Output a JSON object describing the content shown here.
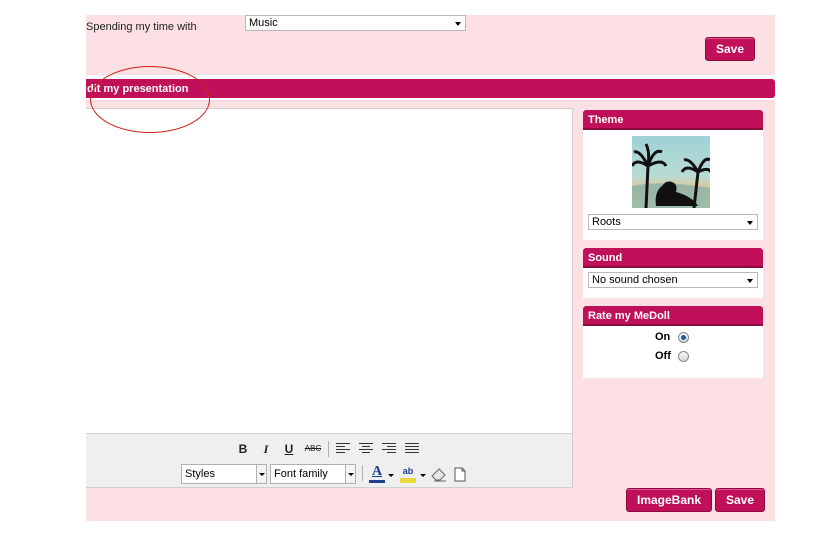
{
  "top": {
    "spending_label": "Spending my time with",
    "spending_value": "Music",
    "save_label": "Save"
  },
  "header": {
    "title": "dit my presentation"
  },
  "toolbar": {
    "bold": "B",
    "italic": "I",
    "underline": "U",
    "strikethrough": "ABC",
    "styles": "Styles",
    "font_family": "Font family",
    "font_color_letter": "A",
    "highlight_letters": "ab"
  },
  "theme": {
    "title": "Theme",
    "selected": "Roots"
  },
  "sound": {
    "title": "Sound",
    "selected": "No sound chosen"
  },
  "rate": {
    "title": "Rate my MeDoll",
    "on_label": "On",
    "off_label": "Off",
    "selected": "On"
  },
  "footer": {
    "imagebank_label": "ImageBank",
    "save_label": "Save"
  },
  "colors": {
    "accent": "#c0105a",
    "panel_bg": "#fde0e3"
  }
}
